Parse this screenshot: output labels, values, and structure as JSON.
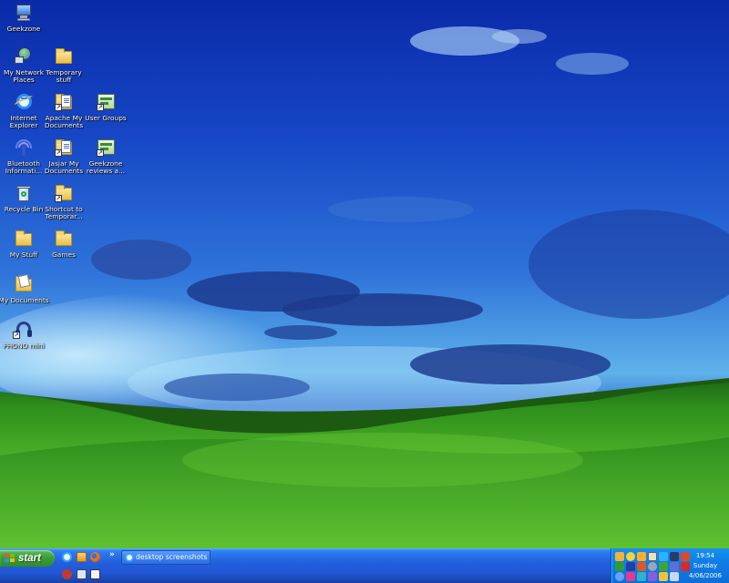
{
  "desktop": {
    "icons": [
      {
        "label": "Geekzone",
        "icon": "computer-icon"
      },
      {
        "label": "My Network\nPlaces",
        "icon": "network-places-icon"
      },
      {
        "label": "Temporary\nstuff",
        "icon": "folder-icon"
      },
      {
        "label": "Internet\nExplorer",
        "icon": "internet-explorer-icon"
      },
      {
        "label": "Apache My\nDocuments",
        "icon": "folder-shortcut-icon"
      },
      {
        "label": "User Groups",
        "icon": "web-shortcut-icon"
      },
      {
        "label": "Bluetooth\nInformati...",
        "icon": "bluetooth-icon"
      },
      {
        "label": "Jasjar My\nDocuments",
        "icon": "folder-shortcut-icon"
      },
      {
        "label": "Geekzone\nreviews a...",
        "icon": "web-shortcut-icon"
      },
      {
        "label": "Recycle Bin",
        "icon": "recycle-bin-icon"
      },
      {
        "label": "Shortcut to\nTemporar...",
        "icon": "folder-shortcut-icon"
      },
      {
        "label": "My Stuff",
        "icon": "folder-icon"
      },
      {
        "label": "Games",
        "icon": "folder-icon"
      },
      {
        "label": "My Documents",
        "icon": "my-documents-icon"
      },
      {
        "label": "PHONO mini",
        "icon": "headphones-icon"
      }
    ]
  },
  "taskbar": {
    "start_label": "start",
    "open_window_label": "desktop screenshots ...",
    "chevron": "»",
    "quick_launch_icons": [
      "internet-explorer-icon",
      "media-icon",
      "firefox-icon",
      "app-icon",
      "app-icon",
      "app-icon"
    ]
  },
  "clock": {
    "time": "19:54",
    "day": "Sunday",
    "date": "4/06/2006"
  },
  "colors": {
    "start_green": "#3c9e37",
    "taskbar_blue": "#245edb",
    "tray_blue": "#0e7ee6"
  }
}
